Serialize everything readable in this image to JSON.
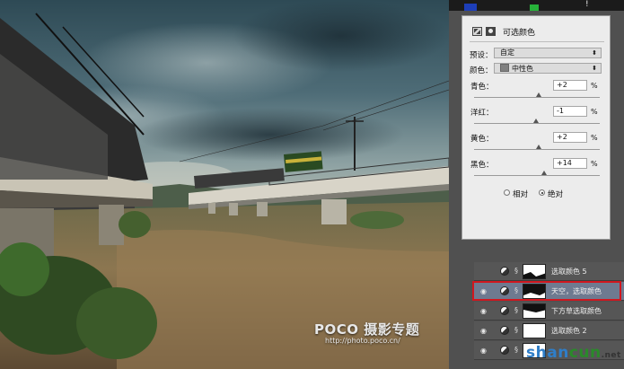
{
  "properties_panel": {
    "title": "可选颜色",
    "preset_label": "预设：",
    "preset_value": "自定",
    "colors_label": "颜色：",
    "colors_value": "中性色",
    "sliders": [
      {
        "label": "青色：",
        "value": "+2",
        "unit": "%"
      },
      {
        "label": "洋红：",
        "value": "-1",
        "unit": "%"
      },
      {
        "label": "黄色：",
        "value": "+2",
        "unit": "%"
      },
      {
        "label": "黑色：",
        "value": "+14",
        "unit": "%"
      }
    ],
    "method_relative": "相对",
    "method_absolute": "绝对",
    "method_selected": "绝对"
  },
  "layers": [
    {
      "name": "选取颜色 5",
      "visible": false
    },
    {
      "name": "天空，选取颜色",
      "visible": true,
      "selected": true
    },
    {
      "name": "下方草选取颜色",
      "visible": true
    },
    {
      "name": "选取颜色 2",
      "visible": true
    },
    {
      "name": "",
      "visible": true
    }
  ],
  "histogram_warning": "!",
  "watermark": {
    "poco": "POCO 摄影专题",
    "url": "http://photo.poco.cn/"
  },
  "site_logo": {
    "part1": "shan",
    "part2": "cun",
    "suffix": ".net"
  },
  "colors": {
    "selected_layer": "#6e7a90",
    "highlight_box": "#d0171f",
    "panel_bg": "#ececec"
  }
}
